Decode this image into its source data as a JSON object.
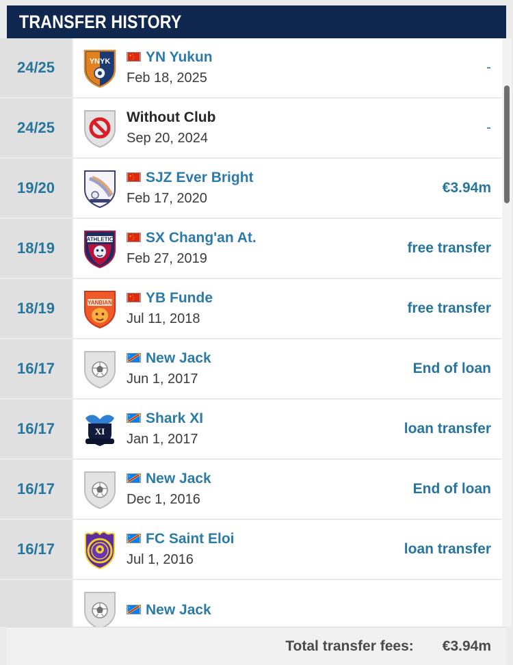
{
  "header": {
    "title": "TRANSFER HISTORY"
  },
  "footer": {
    "label": "Total transfer fees:",
    "value": "€3.94m"
  },
  "colors": {
    "header_bg": "#10284f",
    "link": "#2b7aa8",
    "season": "#26759c",
    "page_bg": "#ebebeb"
  },
  "rows": [
    {
      "season": "24/25",
      "club": "YN Yukun",
      "date": "Feb 18, 2025",
      "fee": "-",
      "flag": "cn",
      "crest": "yn-yukun-crest"
    },
    {
      "season": "24/25",
      "club": "Without Club",
      "date": "Sep 20, 2024",
      "fee": "-",
      "flag": "",
      "crest": "without-club-crest"
    },
    {
      "season": "19/20",
      "club": "SJZ Ever Bright",
      "date": "Feb 17, 2020",
      "fee": "€3.94m",
      "flag": "cn",
      "crest": "sjz-ever-bright-crest"
    },
    {
      "season": "18/19",
      "club": "SX Chang'an At.",
      "date": "Feb 27, 2019",
      "fee": "free transfer",
      "flag": "cn",
      "crest": "sx-changan-crest"
    },
    {
      "season": "18/19",
      "club": "YB Funde",
      "date": "Jul 11, 2018",
      "fee": "free transfer",
      "flag": "cn",
      "crest": "yb-funde-crest"
    },
    {
      "season": "16/17",
      "club": "New Jack",
      "date": "Jun 1, 2017",
      "fee": "End of loan",
      "flag": "cd",
      "crest": "generic-ball-crest"
    },
    {
      "season": "16/17",
      "club": "Shark XI",
      "date": "Jan 1, 2017",
      "fee": "loan transfer",
      "flag": "cd",
      "crest": "shark-xi-crest"
    },
    {
      "season": "16/17",
      "club": "New Jack",
      "date": "Dec 1, 2016",
      "fee": "End of loan",
      "flag": "cd",
      "crest": "generic-ball-crest"
    },
    {
      "season": "16/17",
      "club": "FC Saint Eloi",
      "date": "Jul 1, 2016",
      "fee": "loan transfer",
      "flag": "cd",
      "crest": "fc-saint-eloi-crest"
    },
    {
      "season": "",
      "club": "New Jack",
      "date": "",
      "fee": "",
      "flag": "cd",
      "crest": "generic-ball-crest"
    }
  ],
  "scrollbar": {
    "thumb_top_pct": 8,
    "thumb_height_pct": 20
  }
}
